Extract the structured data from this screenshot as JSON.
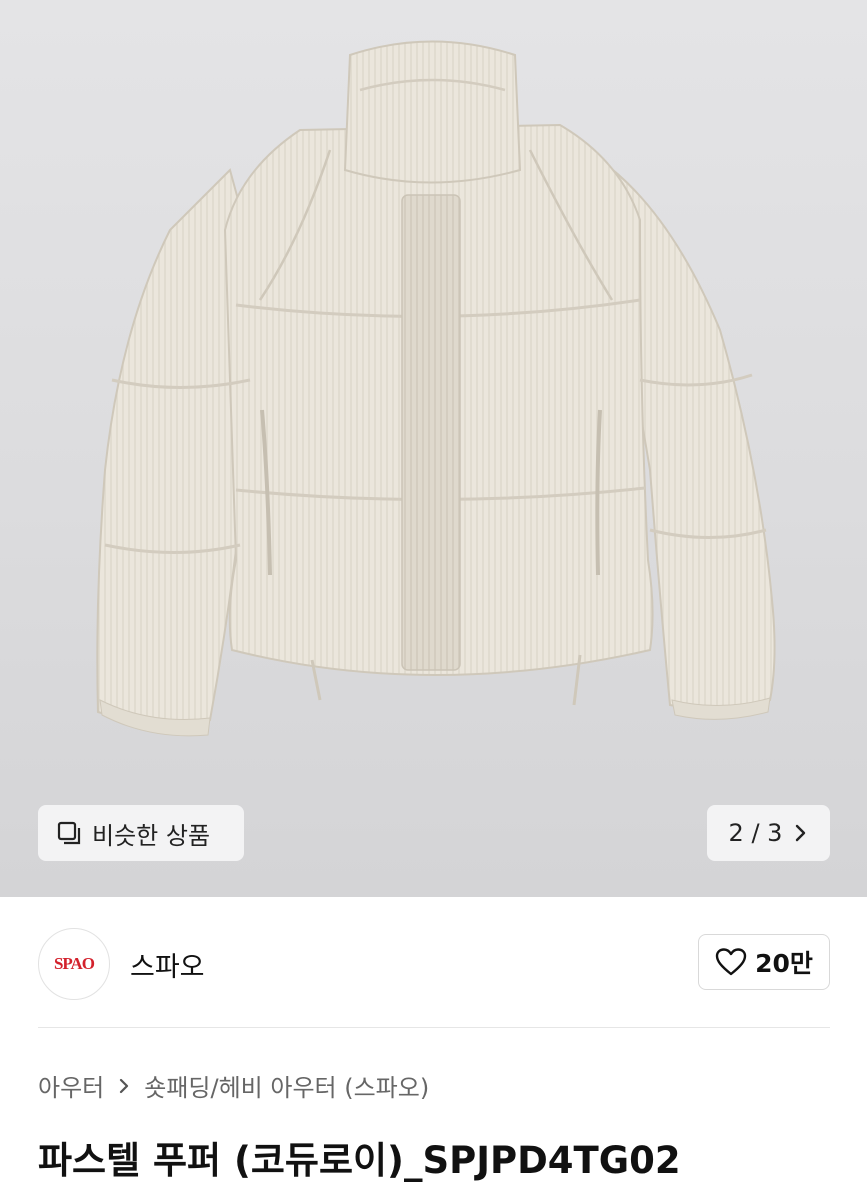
{
  "product_image": {
    "similar_button": {
      "label": "비슷한 상품"
    },
    "pagination": {
      "current": "2",
      "separator": "/",
      "total": "3",
      "text": "2 / 3"
    }
  },
  "seller": {
    "logo_text": "SPAO",
    "brand_name": "스파오",
    "like_count": "20만"
  },
  "breadcrumb": {
    "category": "아우터",
    "subcategory": "숏패딩/헤비 아우터 (스파오)"
  },
  "product": {
    "title": "파스텔 푸퍼 (코듀로이)_SPJPD4TG02"
  },
  "colors": {
    "brand_red": "#d3212c",
    "jacket": "#ebe6dc"
  }
}
